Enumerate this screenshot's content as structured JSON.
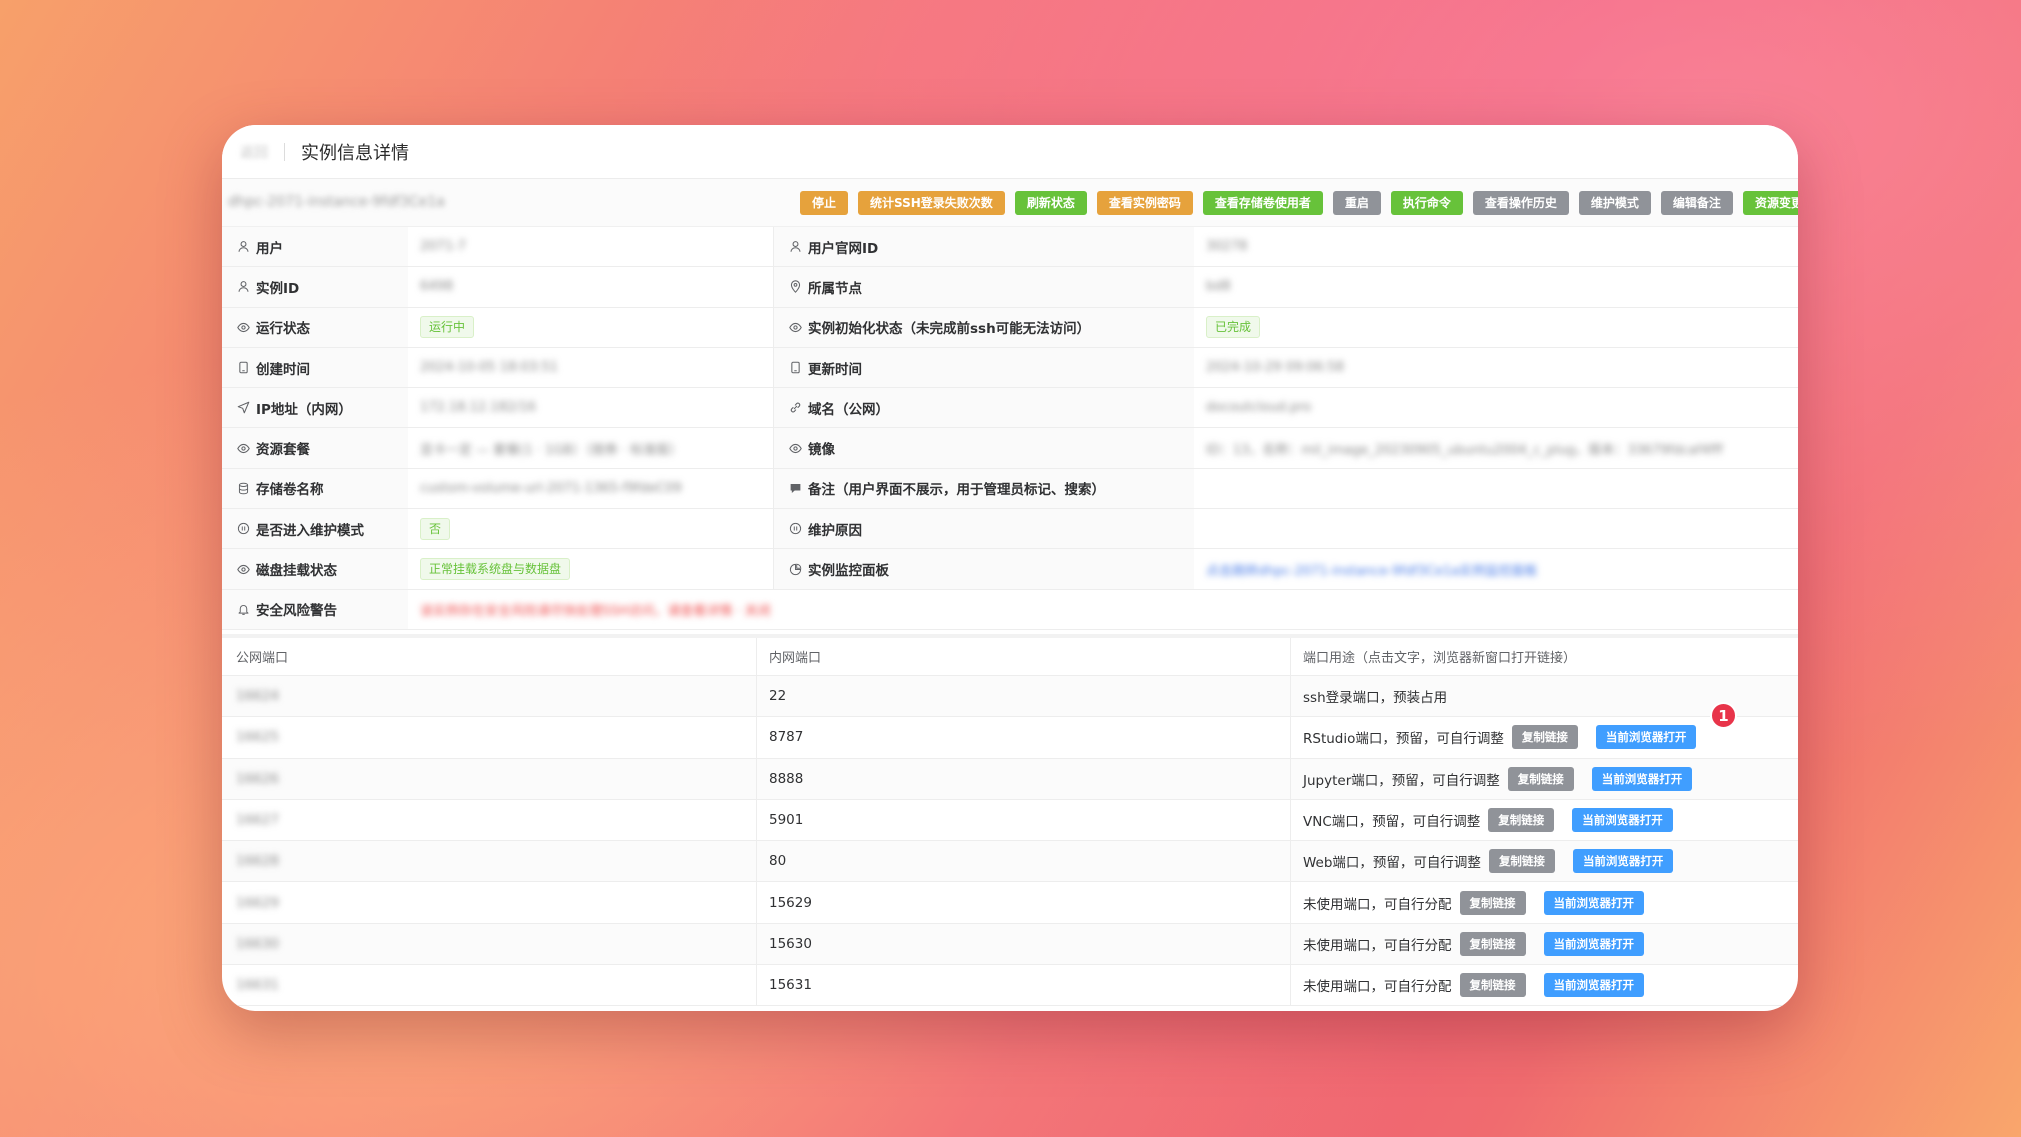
{
  "header": {
    "back_label": "返回",
    "title": "实例信息详情"
  },
  "toolbar": {
    "instance_name": "dhpc-2071-instance-9fdf3Ce1a",
    "buttons": [
      {
        "label": "停止",
        "color": "orange"
      },
      {
        "label": "统计SSH登录失败次数",
        "color": "orange"
      },
      {
        "label": "刷新状态",
        "color": "green"
      },
      {
        "label": "查看实例密码",
        "color": "orange"
      },
      {
        "label": "查看存储卷使用者",
        "color": "green"
      },
      {
        "label": "重启",
        "color": "gray"
      },
      {
        "label": "执行命令",
        "color": "green"
      },
      {
        "label": "查看操作历史",
        "color": "gray"
      },
      {
        "label": "维护模式",
        "color": "gray"
      },
      {
        "label": "编辑备注",
        "color": "gray"
      },
      {
        "label": "资源变更",
        "color": "green"
      }
    ]
  },
  "info": {
    "user_label": "用户",
    "user_value": "2071-7",
    "user_official_id_label": "用户官网ID",
    "user_official_id_value": "30278",
    "instance_id_label": "实例ID",
    "instance_id_value": "6498",
    "node_label": "所属节点",
    "node_value": "bd8",
    "run_status_label": "运行状态",
    "run_status_value": "运行中",
    "init_status_label": "实例初始化状态（未完成前ssh可能无法访问）",
    "init_status_value": "已完成",
    "created_label": "创建时间",
    "created_value": "2024-10-05 18:03:51",
    "updated_label": "更新时间",
    "updated_value": "2024-10-29 09:06:58",
    "ip_label": "IP地址（内网）",
    "ip_value": "172.18.12.182/16",
    "domain_label": "域名（公网）",
    "domain_value": "docoutcloud.pro",
    "package_label": "资源套餐",
    "package_value": "显卡一定 — 套餐(1 · 1GB）（按券 · 标准版）",
    "image_label": "镜像",
    "image_value": "ID：13，名称：mil_image_20230905_ubuntu2004_c_plug，版本：33679fdcaf4fff",
    "volume_label": "存储卷名称",
    "volume_value": "custom-volume-url-2071-1365-f9fdeC09",
    "remark_label": "备注（用户界面不展示，用于管理员标记、搜索）",
    "remark_value": "",
    "maint_label": "是否进入维护模式",
    "maint_value": "否",
    "maint_reason_label": "维护原因",
    "maint_reason_value": "",
    "disk_label": "磁盘挂载状态",
    "disk_value": "正常挂载系统盘与数据盘",
    "monitor_label": "实例监控面板",
    "monitor_value": "点击跳转dhpc-2071-instance-9fdf3Ce1a实例监控面板",
    "risk_label": "安全风险警告",
    "risk_value": "该实例存在安全风险请尽快处理SSH访问，请查看详情 · 关闭"
  },
  "ports": {
    "headers": [
      "公网端口",
      "内网端口",
      "端口用途（点击文字，浏览器新窗口打开链接）"
    ],
    "copy_label": "复制链接",
    "open_label": "当前浏览器打开",
    "rows": [
      {
        "public": "16624",
        "internal": "22",
        "usage": "ssh登录端口，预装占用",
        "buttons": false
      },
      {
        "public": "16625",
        "internal": "8787",
        "usage": "RStudio端口，预留，可自行调整",
        "buttons": true
      },
      {
        "public": "16626",
        "internal": "8888",
        "usage": "Jupyter端口，预留，可自行调整",
        "buttons": true
      },
      {
        "public": "16627",
        "internal": "5901",
        "usage": "VNC端口，预留，可自行调整",
        "buttons": true
      },
      {
        "public": "16628",
        "internal": "80",
        "usage": "Web端口，预留，可自行调整",
        "buttons": true
      },
      {
        "public": "16629",
        "internal": "15629",
        "usage": "未使用端口，可自行分配",
        "buttons": true
      },
      {
        "public": "16630",
        "internal": "15630",
        "usage": "未使用端口，可自行分配",
        "buttons": true
      },
      {
        "public": "16631",
        "internal": "15631",
        "usage": "未使用端口，可自行分配",
        "buttons": true
      }
    ]
  },
  "badge": {
    "label": "1"
  }
}
